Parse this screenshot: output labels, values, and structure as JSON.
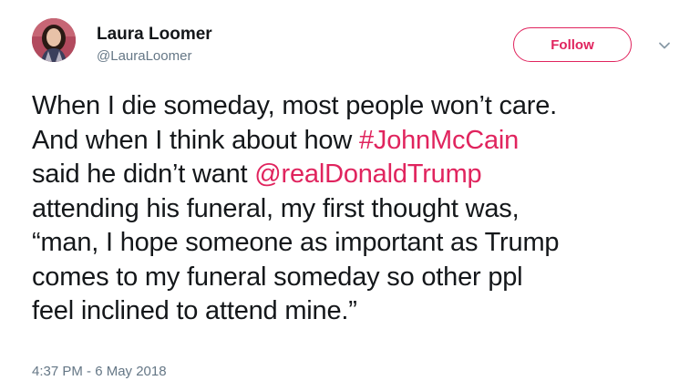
{
  "author": {
    "display_name": "Laura Loomer",
    "handle": "@LauraLoomer"
  },
  "follow_button": {
    "label": "Follow"
  },
  "colors": {
    "accent": "#e0245e",
    "text": "#14171a",
    "secondary": "#657786"
  },
  "icons": {
    "menu": "chevron-down-icon"
  },
  "tweet": {
    "line1": "When I die someday, most people won’t care.",
    "line2_pre": "And when I think about how ",
    "hashtag": "#JohnMcCain",
    "line3_pre": "said he didn’t want ",
    "mention": "@realDonaldTrump",
    "line4": "attending his funeral, my first thought was,",
    "line5": "“man, I hope someone as important as Trump",
    "line6": "comes to my funeral someday so other ppl",
    "line7": "feel inclined to attend mine.”"
  },
  "timestamp": "4:37 PM - 6 May 2018"
}
